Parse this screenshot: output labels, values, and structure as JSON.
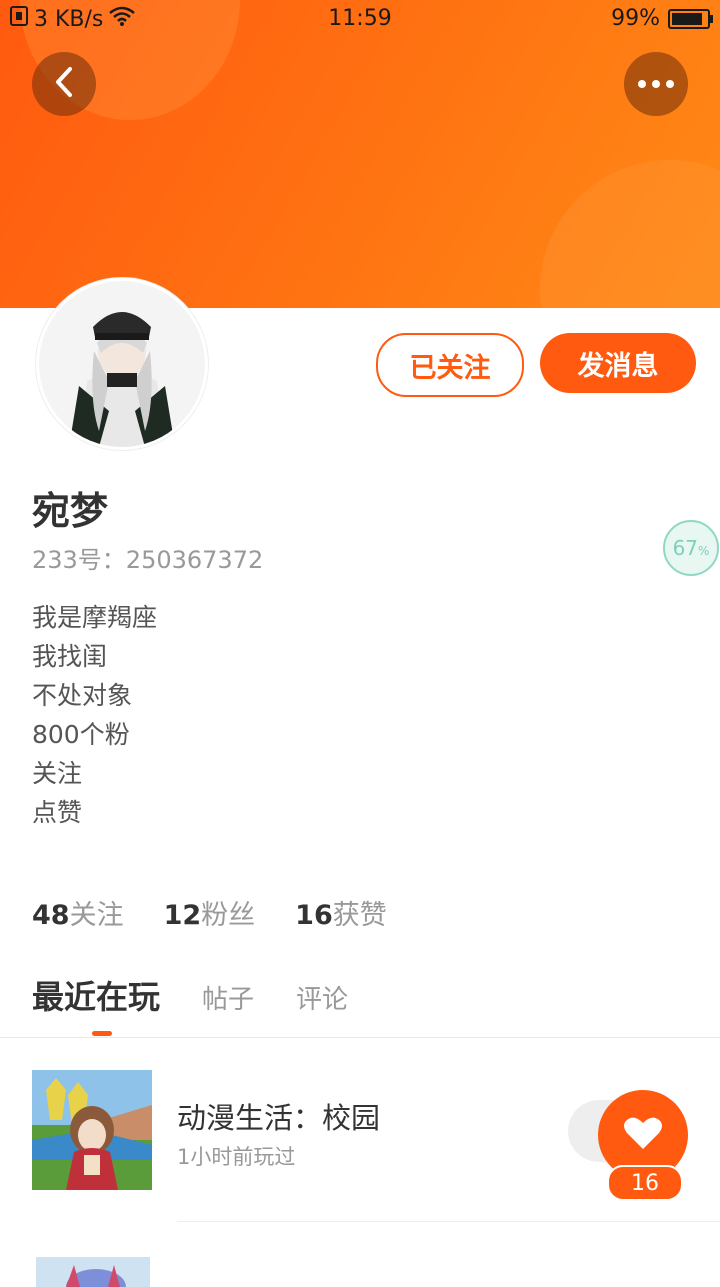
{
  "status": {
    "network_speed": "3 KB/s",
    "time": "11:59",
    "battery": "99%"
  },
  "header": {
    "back_icon": "chevron-left-icon",
    "more_icon": "more-dots-icon"
  },
  "profile": {
    "name": "宛梦",
    "uid": "233号：250367372",
    "completion": "67",
    "completion_unit": "%",
    "bio": [
      "我是摩羯座",
      "我找闺",
      "不处对象",
      "800个粉",
      "关注",
      "点赞"
    ],
    "followed_label": "已关注",
    "message_label": "发消息"
  },
  "stats": [
    {
      "value": "48",
      "label": "关注"
    },
    {
      "value": "12",
      "label": "粉丝"
    },
    {
      "value": "16",
      "label": "获赞"
    }
  ],
  "tabs": [
    {
      "label": "最近在玩",
      "active": true
    },
    {
      "label": "帖子",
      "active": false
    },
    {
      "label": "评论",
      "active": false
    }
  ],
  "games": [
    {
      "title": "动漫生活：校园",
      "subtitle": "1小时前玩过",
      "likes": "16"
    }
  ],
  "colors": {
    "accent": "#ff5a10",
    "banner_end": "#ff8a16"
  }
}
